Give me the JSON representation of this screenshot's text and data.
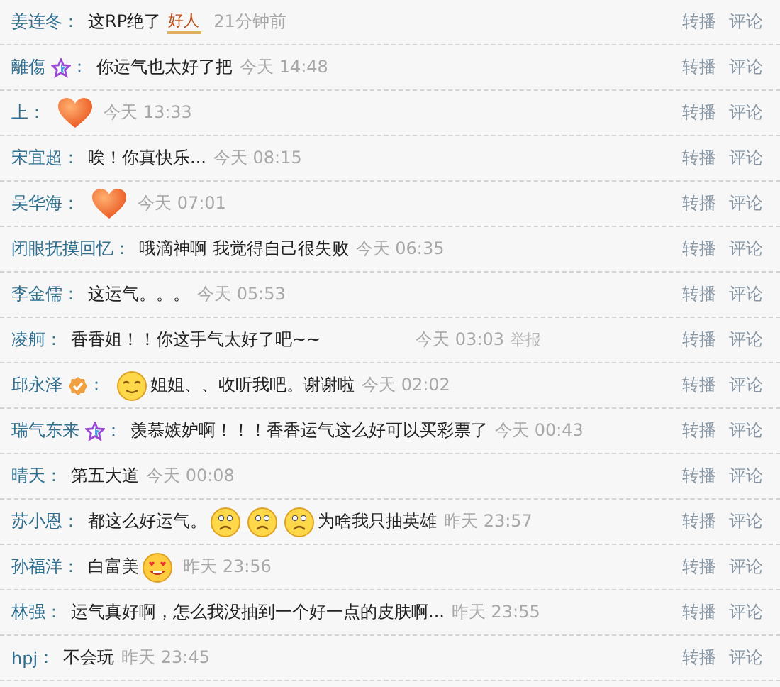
{
  "comments": [
    {
      "user": "姜连冬",
      "sep": "：",
      "parts": [
        {
          "kind": "text",
          "text": "这RP绝了"
        },
        {
          "kind": "tag",
          "text": "好人"
        }
      ],
      "time": "21分钟前",
      "actions": [
        "转播",
        "评论"
      ]
    },
    {
      "user": "離傷",
      "user_badge": {
        "kind": "star"
      },
      "sep": "：",
      "parts": [
        {
          "kind": "text",
          "text": "你运气也太好了把"
        }
      ],
      "time": "今天 14:48",
      "actions": [
        "转播",
        "评论"
      ]
    },
    {
      "user": "上",
      "sep": "：",
      "parts": [
        {
          "kind": "heart"
        }
      ],
      "time": "今天 13:33",
      "actions": [
        "转播",
        "评论"
      ]
    },
    {
      "user": "宋宜超",
      "sep": "：",
      "parts": [
        {
          "kind": "text",
          "text": "唉！你真快乐..."
        }
      ],
      "time": "今天 08:15",
      "actions": [
        "转播",
        "评论"
      ]
    },
    {
      "user": "吴华海",
      "sep": "：",
      "parts": [
        {
          "kind": "heart"
        }
      ],
      "time": "今天 07:01",
      "actions": [
        "转播",
        "评论"
      ]
    },
    {
      "user": "闭眼抚摸回忆",
      "sep": "：",
      "parts": [
        {
          "kind": "text",
          "text": "哦滴神啊 我觉得自己很失败"
        }
      ],
      "time": "今天 06:35",
      "actions": [
        "转播",
        "评论"
      ]
    },
    {
      "user": "李金儒",
      "sep": "：",
      "parts": [
        {
          "kind": "text",
          "text": "这运气。。。"
        }
      ],
      "time": "今天 05:53",
      "actions": [
        "转播",
        "评论"
      ]
    },
    {
      "user": "凌舸",
      "sep": "：",
      "parts": [
        {
          "kind": "text",
          "text": "香香姐！！你这手气太好了吧~~"
        },
        {
          "kind": "space"
        }
      ],
      "time": "今天 03:03",
      "report": "举报",
      "actions": [
        "转播",
        "评论"
      ]
    },
    {
      "user": "邱永泽",
      "user_badge": {
        "kind": "verified"
      },
      "sep": "：",
      "parts": [
        {
          "kind": "smile"
        },
        {
          "kind": "text",
          "text": "姐姐、、收听我吧。谢谢啦"
        }
      ],
      "time": "今天 02:02",
      "actions": [
        "转播",
        "评论"
      ]
    },
    {
      "user": "瑞气东来",
      "user_badge": {
        "kind": "star"
      },
      "sep": "：",
      "parts": [
        {
          "kind": "text",
          "text": "羡慕嫉妒啊！！！香香运气这么好可以买彩票了"
        }
      ],
      "time": "今天 00:43",
      "actions": [
        "转播",
        "评论"
      ]
    },
    {
      "user": "晴天",
      "sep": "：",
      "parts": [
        {
          "kind": "text",
          "text": "第五大道"
        }
      ],
      "time": "今天 00:08",
      "actions": [
        "转播",
        "评论"
      ]
    },
    {
      "user": "苏小恩",
      "sep": "：",
      "parts": [
        {
          "kind": "text",
          "text": "都这么好运气。"
        },
        {
          "kind": "sad"
        },
        {
          "kind": "sad"
        },
        {
          "kind": "sad"
        },
        {
          "kind": "text",
          "text": "为啥我只抽英雄"
        }
      ],
      "time": "昨天 23:57",
      "actions": [
        "转播",
        "评论"
      ]
    },
    {
      "user": "孙福洋",
      "sep": "：",
      "parts": [
        {
          "kind": "text",
          "text": "白富美"
        },
        {
          "kind": "drool"
        }
      ],
      "time": "昨天 23:56",
      "actions": [
        "转播",
        "评论"
      ]
    },
    {
      "user": "林强",
      "sep": "：",
      "parts": [
        {
          "kind": "text",
          "text": "运气真好啊，怎么我没抽到一个好一点的皮肤啊..."
        }
      ],
      "time": "昨天 23:55",
      "actions": [
        "转播",
        "评论"
      ]
    },
    {
      "user": "hpj",
      "sep": "：",
      "parts": [
        {
          "kind": "text",
          "text": "不会玩"
        }
      ],
      "time": "昨天 23:45",
      "actions": [
        "转播",
        "评论"
      ]
    }
  ]
}
